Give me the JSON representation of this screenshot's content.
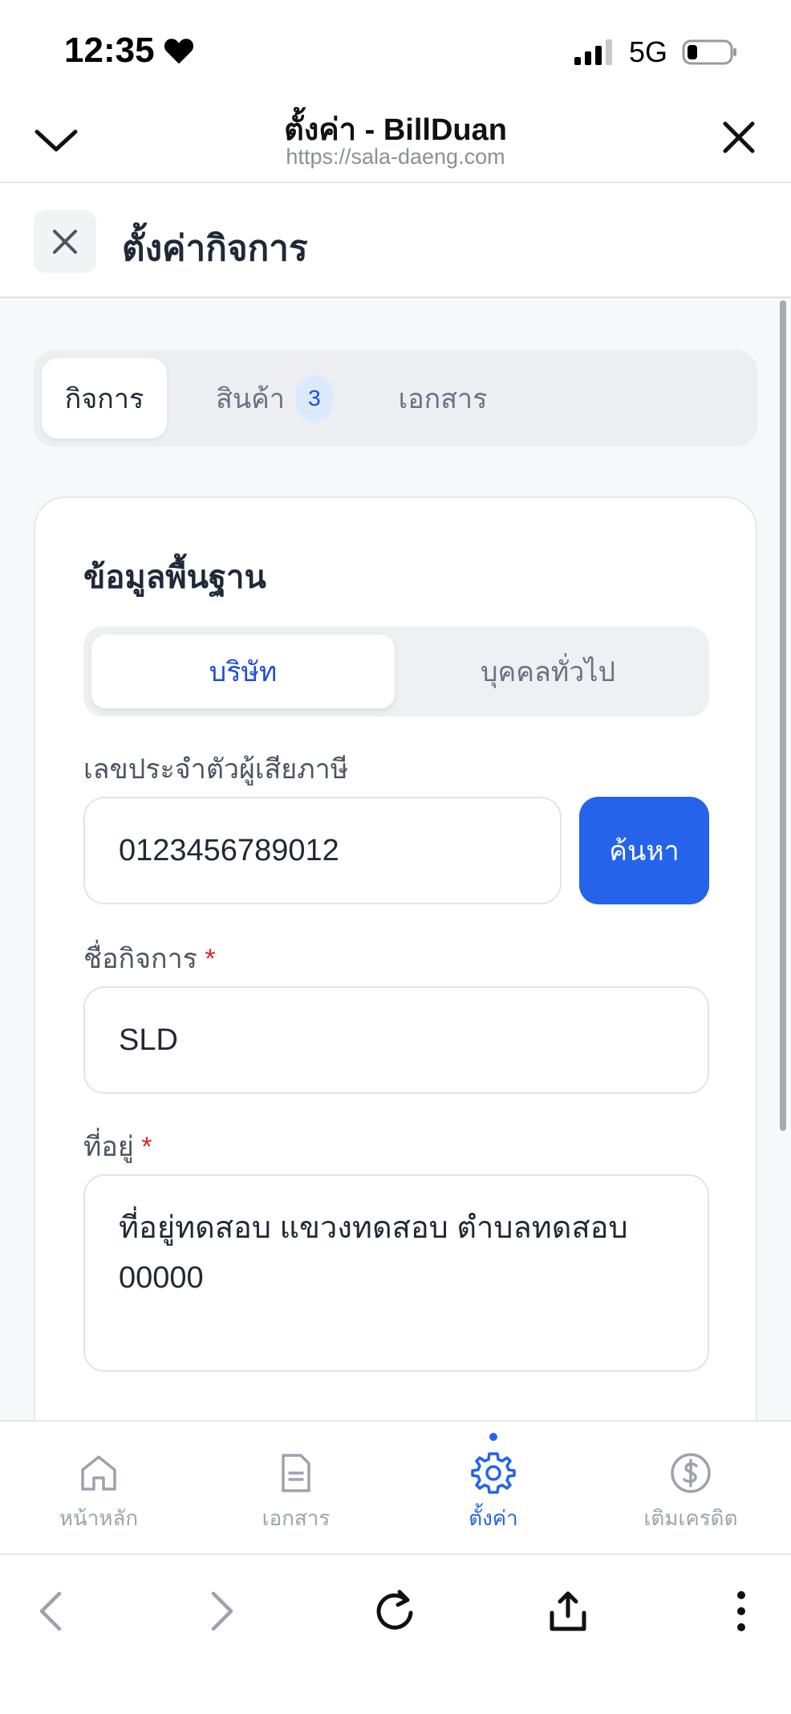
{
  "status_bar": {
    "time": "12:35",
    "network": "5G"
  },
  "browser": {
    "title": "ตั้งค่า - BillDuan",
    "url": "https://sala-daeng.com"
  },
  "page": {
    "title": "ตั้งค่ากิจการ"
  },
  "tabs": [
    {
      "label": "กิจการ",
      "active": true
    },
    {
      "label": "สินค้า",
      "badge": "3"
    },
    {
      "label": "เอกสาร"
    }
  ],
  "card": {
    "title": "ข้อมูลพื้นฐาน",
    "segment": {
      "options": [
        "บริษัท",
        "บุคคลทั่วไป"
      ],
      "selected": "บริษัท"
    },
    "tax_id": {
      "label": "เลขประจำตัวผู้เสียภาษี",
      "value": "0123456789012",
      "button": "ค้นหา"
    },
    "business_name": {
      "label": "ชื่อกิจการ",
      "required_mark": "*",
      "value": "SLD"
    },
    "address": {
      "label": "ที่อยู่",
      "required_mark": "*",
      "value": "ที่อยู่ทดสอบ แขวงทดสอบ ตำบลทดสอบ 00000"
    }
  },
  "bottom_nav": [
    {
      "label": "หน้าหลัก",
      "icon": "home-icon"
    },
    {
      "label": "เอกสาร",
      "icon": "document-icon"
    },
    {
      "label": "ตั้งค่า",
      "icon": "gear-icon",
      "active": true
    },
    {
      "label": "เติมเครดิต",
      "icon": "dollar-icon"
    }
  ],
  "colors": {
    "accent": "#2563eb",
    "required": "#dc2626",
    "badge_bg": "#dbeafe"
  }
}
